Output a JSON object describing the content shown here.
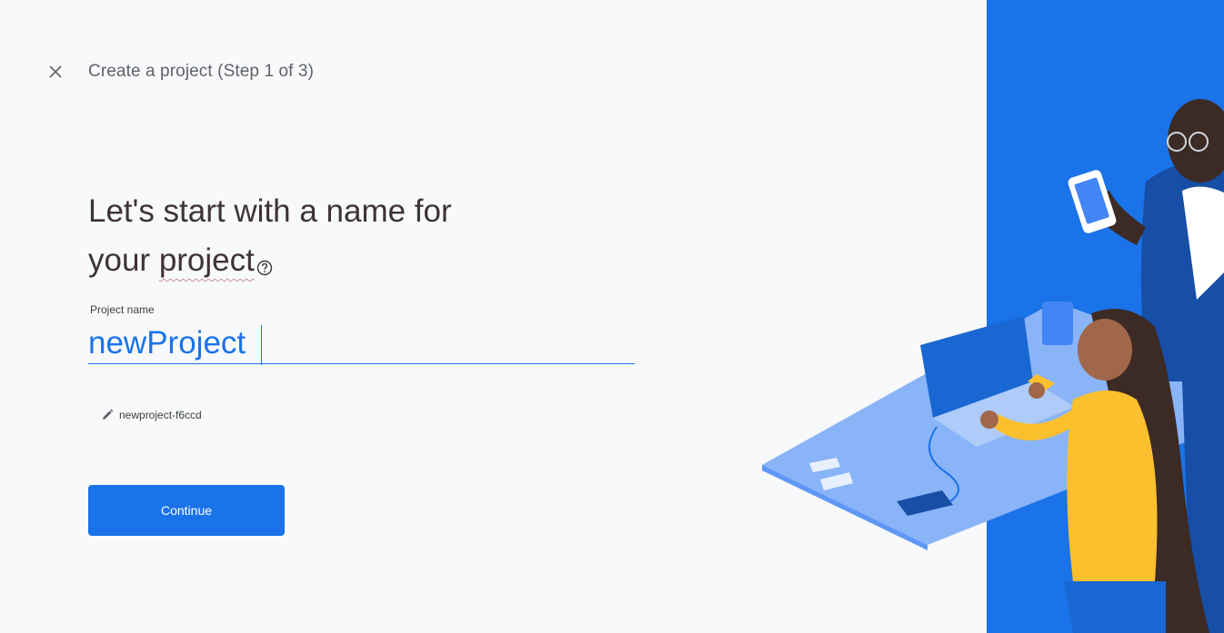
{
  "header": {
    "close_icon": "close-icon",
    "title": "Create a project (Step 1 of 3)"
  },
  "headline": {
    "line1": "Let's start with a name for",
    "line2_prefix": "your ",
    "line2_word": "project",
    "help_icon": "help-circle-icon"
  },
  "form": {
    "label": "Project name",
    "value": "newProject"
  },
  "project_id": {
    "icon": "pencil-icon",
    "value": "newproject-f6ccd"
  },
  "actions": {
    "continue_label": "Continue"
  },
  "colors": {
    "accent": "#1a73e8",
    "panel_blue": "#1a73e8",
    "background": "#f8f9fa"
  }
}
